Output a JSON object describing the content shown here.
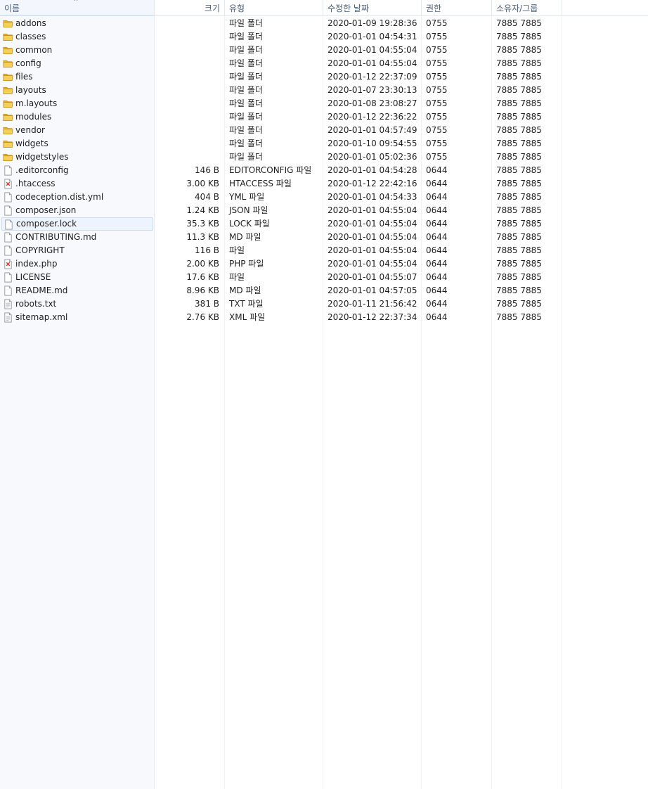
{
  "columns": {
    "name": "이름",
    "size": "크기",
    "type": "유형",
    "modified": "수정한 날짜",
    "permissions": "권한",
    "owner": "소유자/그룹"
  },
  "sort_indicator": "^",
  "selected_row": "composer.lock",
  "files": [
    {
      "name": "addons",
      "size": "",
      "type": "파일 폴더",
      "modified": "2020-01-09 19:28:36",
      "permissions": "0755",
      "owner": "7885 7885",
      "icon": "folder-icon"
    },
    {
      "name": "classes",
      "size": "",
      "type": "파일 폴더",
      "modified": "2020-01-01 04:54:31",
      "permissions": "0755",
      "owner": "7885 7885",
      "icon": "folder-icon"
    },
    {
      "name": "common",
      "size": "",
      "type": "파일 폴더",
      "modified": "2020-01-01 04:55:04",
      "permissions": "0755",
      "owner": "7885 7885",
      "icon": "folder-icon"
    },
    {
      "name": "config",
      "size": "",
      "type": "파일 폴더",
      "modified": "2020-01-01 04:55:04",
      "permissions": "0755",
      "owner": "7885 7885",
      "icon": "folder-icon"
    },
    {
      "name": "files",
      "size": "",
      "type": "파일 폴더",
      "modified": "2020-01-12 22:37:09",
      "permissions": "0755",
      "owner": "7885 7885",
      "icon": "folder-icon"
    },
    {
      "name": "layouts",
      "size": "",
      "type": "파일 폴더",
      "modified": "2020-01-07 23:30:13",
      "permissions": "0755",
      "owner": "7885 7885",
      "icon": "folder-icon"
    },
    {
      "name": "m.layouts",
      "size": "",
      "type": "파일 폴더",
      "modified": "2020-01-08 23:08:27",
      "permissions": "0755",
      "owner": "7885 7885",
      "icon": "folder-icon"
    },
    {
      "name": "modules",
      "size": "",
      "type": "파일 폴더",
      "modified": "2020-01-12 22:36:22",
      "permissions": "0755",
      "owner": "7885 7885",
      "icon": "folder-icon"
    },
    {
      "name": "vendor",
      "size": "",
      "type": "파일 폴더",
      "modified": "2020-01-01 04:57:49",
      "permissions": "0755",
      "owner": "7885 7885",
      "icon": "folder-icon"
    },
    {
      "name": "widgets",
      "size": "",
      "type": "파일 폴더",
      "modified": "2020-01-10 09:54:55",
      "permissions": "0755",
      "owner": "7885 7885",
      "icon": "folder-icon"
    },
    {
      "name": "widgetstyles",
      "size": "",
      "type": "파일 폴더",
      "modified": "2020-01-01 05:02:36",
      "permissions": "0755",
      "owner": "7885 7885",
      "icon": "folder-icon"
    },
    {
      "name": ".editorconfig",
      "size": "146 B",
      "type": "EDITORCONFIG 파일",
      "modified": "2020-01-01 04:54:28",
      "permissions": "0644",
      "owner": "7885 7885",
      "icon": "blank-file-icon"
    },
    {
      "name": ".htaccess",
      "size": "3.00 KB",
      "type": "HTACCESS 파일",
      "modified": "2020-01-12 22:42:16",
      "permissions": "0644",
      "owner": "7885 7885",
      "icon": "script-file-icon"
    },
    {
      "name": "codeception.dist.yml",
      "size": "404 B",
      "type": "YML 파일",
      "modified": "2020-01-01 04:54:33",
      "permissions": "0644",
      "owner": "7885 7885",
      "icon": "blank-file-icon"
    },
    {
      "name": "composer.json",
      "size": "1.24 KB",
      "type": "JSON 파일",
      "modified": "2020-01-01 04:55:04",
      "permissions": "0644",
      "owner": "7885 7885",
      "icon": "blank-file-icon"
    },
    {
      "name": "composer.lock",
      "size": "35.3 KB",
      "type": "LOCK 파일",
      "modified": "2020-01-01 04:55:04",
      "permissions": "0644",
      "owner": "7885 7885",
      "icon": "blank-file-icon"
    },
    {
      "name": "CONTRIBUTING.md",
      "size": "11.3 KB",
      "type": "MD 파일",
      "modified": "2020-01-01 04:55:04",
      "permissions": "0644",
      "owner": "7885 7885",
      "icon": "blank-file-icon"
    },
    {
      "name": "COPYRIGHT",
      "size": "116 B",
      "type": "파일",
      "modified": "2020-01-01 04:55:04",
      "permissions": "0644",
      "owner": "7885 7885",
      "icon": "blank-file-icon"
    },
    {
      "name": "index.php",
      "size": "2.00 KB",
      "type": "PHP 파일",
      "modified": "2020-01-01 04:55:04",
      "permissions": "0644",
      "owner": "7885 7885",
      "icon": "script-file-icon"
    },
    {
      "name": "LICENSE",
      "size": "17.6 KB",
      "type": "파일",
      "modified": "2020-01-01 04:55:07",
      "permissions": "0644",
      "owner": "7885 7885",
      "icon": "blank-file-icon"
    },
    {
      "name": "README.md",
      "size": "8.96 KB",
      "type": "MD 파일",
      "modified": "2020-01-01 04:57:05",
      "permissions": "0644",
      "owner": "7885 7885",
      "icon": "blank-file-icon"
    },
    {
      "name": "robots.txt",
      "size": "381 B",
      "type": "TXT 파일",
      "modified": "2020-01-11 21:56:42",
      "permissions": "0644",
      "owner": "7885 7885",
      "icon": "text-file-icon"
    },
    {
      "name": "sitemap.xml",
      "size": "2.76 KB",
      "type": "XML 파일",
      "modified": "2020-01-12 22:37:34",
      "permissions": "0644",
      "owner": "7885 7885",
      "icon": "text-file-icon"
    }
  ]
}
